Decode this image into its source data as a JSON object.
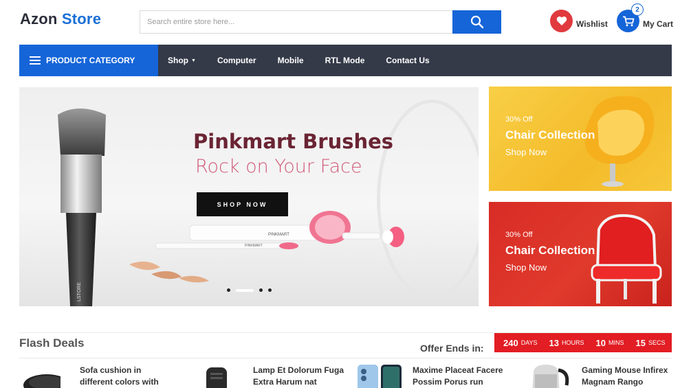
{
  "brand": {
    "part1": "Azon",
    "part2": "Store",
    "accent": "#1565d8"
  },
  "search": {
    "placeholder": "Search entire store here...",
    "value": "",
    "icon": "search-icon"
  },
  "header": {
    "wishlist_label": "Wishlist",
    "cart_label": "My Cart",
    "cart_count": "2",
    "wishlist_color": "#e03a3e"
  },
  "nav": {
    "category_label": "PRODUCT CATEGORY",
    "links": [
      {
        "label": "Shop"
      },
      {
        "label": "Computer"
      },
      {
        "label": "Mobile"
      },
      {
        "label": "RTL Mode"
      },
      {
        "label": "Contact Us"
      }
    ],
    "bg_color": "#343a48"
  },
  "hero": {
    "title": "Pinkmart Brushes",
    "subtitle": "Rock on Your Face",
    "button_label": "SHOP NOW",
    "product_text_1": "PINKMART",
    "product_text_2": "PINKMART",
    "handle_text": "LSTORE",
    "slides": 4,
    "active_slide": 2
  },
  "promos": [
    {
      "discount": "30% Off",
      "title": "Chair Collection",
      "cta": "Shop Now",
      "color": "#f5c232"
    },
    {
      "discount": "30% Off",
      "title": "Chair Collection",
      "cta": "Shop Now",
      "color": "#d82c26"
    }
  ],
  "flash": {
    "title": "Flash Deals",
    "offer_label": "Offer Ends in:",
    "timer": [
      {
        "value": "240",
        "unit": "DAYS"
      },
      {
        "value": "13",
        "unit": "HOURS"
      },
      {
        "value": "10",
        "unit": "MINS"
      },
      {
        "value": "15",
        "unit": "SECS"
      }
    ],
    "products": [
      {
        "name_line1": "Sofa cushion in",
        "name_line2": "different colors with"
      },
      {
        "name_line1": "Lamp Et Dolorum Fuga",
        "name_line2": "Extra Harum nat"
      },
      {
        "name_line1": "Maxime Placeat Facere",
        "name_line2": "Possim Porus run"
      },
      {
        "name_line1": "Gaming Mouse Infirex",
        "name_line2": "Magnam Rango"
      }
    ]
  }
}
